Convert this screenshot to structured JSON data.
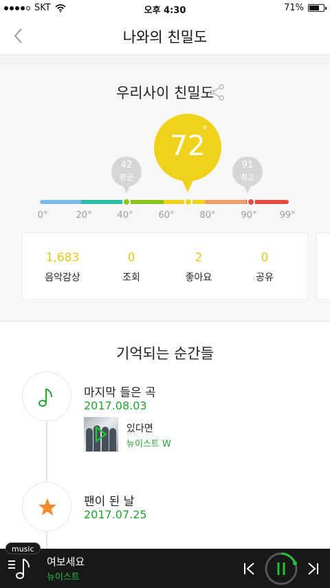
{
  "status_bar": {
    "carrier": "SKT",
    "time": "오후 4:30",
    "battery": "71%",
    "battery_level": 0.71
  },
  "nav": {
    "title": "나와의 친밀도",
    "back_icon": "chevron-left-icon"
  },
  "intimacy": {
    "title": "우리사이 친밀도",
    "share_icon": "share-icon",
    "value": "72",
    "degree_symbol": "°",
    "average": {
      "value": "42",
      "label": "평균"
    },
    "best": {
      "value": "91",
      "label": "최고"
    },
    "scale_ticks": [
      "0°",
      "20°",
      "40°",
      "60°",
      "80°",
      "90°",
      "99°"
    ],
    "marker_values": {
      "average": 42,
      "current": 72,
      "best": 91
    },
    "colors": {
      "accent": "#f0d21c",
      "green": "#8dc21f",
      "red": "#e44b42"
    }
  },
  "stats": [
    {
      "value": "1,683",
      "label": "음악감상"
    },
    {
      "value": "0",
      "label": "조회"
    },
    {
      "value": "2",
      "label": "좋아요"
    },
    {
      "value": "0",
      "label": "공유"
    }
  ],
  "memories": {
    "title": "기억되는 순간들",
    "items": [
      {
        "icon": "music-note-icon",
        "title": "마지막 들은 곡",
        "date": "2017.08.03",
        "song": {
          "title": "있다면",
          "artist": "뉴이스트 W"
        }
      },
      {
        "icon": "star-icon",
        "title": "팬이 된 날",
        "date": "2017.07.25"
      }
    ]
  },
  "player": {
    "tag": "music",
    "title": "여보세요",
    "artist": "뉴이스트",
    "accent": "#25c23b"
  }
}
